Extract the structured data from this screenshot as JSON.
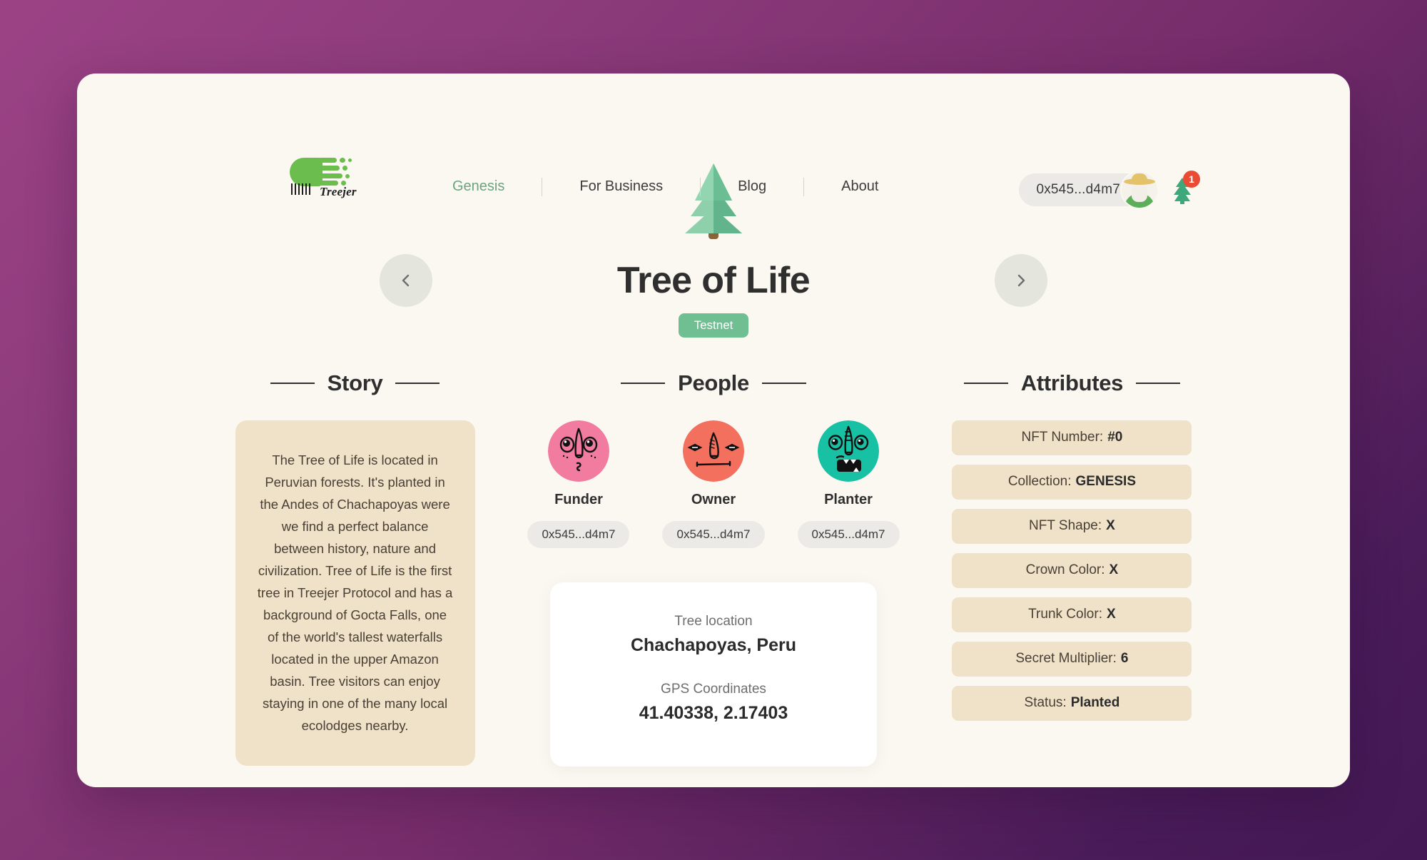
{
  "brand": {
    "name": "Treejer"
  },
  "nav": {
    "items": [
      {
        "label": "Genesis",
        "active": true
      },
      {
        "label": "For Business",
        "active": false
      },
      {
        "label": "Blog",
        "active": false
      },
      {
        "label": "About",
        "active": false
      }
    ]
  },
  "header": {
    "wallet_address": "0x545...d4m7",
    "notification_count": "1",
    "avatar_icon": "farmer-avatar-icon",
    "notification_icon": "tree-icon"
  },
  "hero": {
    "tree_icon": "pine-tree-3d-icon",
    "title": "Tree of Life",
    "badge": "Testnet",
    "prev_icon": "chevron-left-icon",
    "next_icon": "chevron-right-icon"
  },
  "story": {
    "heading": "Story",
    "text": "The Tree of Life is located in Peruvian forests. It's planted in the Andes of Chachapoyas were we find a perfect balance between history, nature and civilization. Tree of Life is the first tree in Treejer Protocol and has a background of Gocta Falls, one of the world's tallest waterfalls located in the upper Amazon basin. Tree visitors can enjoy staying in one of the many local ecolodges nearby."
  },
  "people": {
    "heading": "People",
    "members": [
      {
        "role": "Funder",
        "address": "0x545...d4m7",
        "avatar_color": "#F27BA0"
      },
      {
        "role": "Owner",
        "address": "0x545...d4m7",
        "avatar_color": "#F4705E"
      },
      {
        "role": "Planter",
        "address": "0x545...d4m7",
        "avatar_color": "#18C1A4"
      }
    ],
    "location_card": {
      "location_label": "Tree location",
      "location_value": "Chachapoyas, Peru",
      "gps_label": "GPS Coordinates",
      "gps_value": "41.40338, 2.17403"
    }
  },
  "attributes": {
    "heading": "Attributes",
    "items": [
      {
        "label": "NFT Number:",
        "value": "#0"
      },
      {
        "label": "Collection:",
        "value": "GENESIS"
      },
      {
        "label": "NFT Shape:",
        "value": "X"
      },
      {
        "label": "Crown Color:",
        "value": "X"
      },
      {
        "label": "Trunk Color:",
        "value": "X"
      },
      {
        "label": "Secret Multiplier:",
        "value": "6"
      },
      {
        "label": "Status:",
        "value": "Planted"
      }
    ]
  },
  "colors": {
    "page_bg": "#FBF8F2",
    "accent_green": "#6BA47F",
    "badge_green": "#6FBF93",
    "card_tan": "#EFE2C8",
    "notif_red": "#E94B35",
    "bg_gradient_start": "#9B4285",
    "bg_gradient_end": "#431854"
  }
}
